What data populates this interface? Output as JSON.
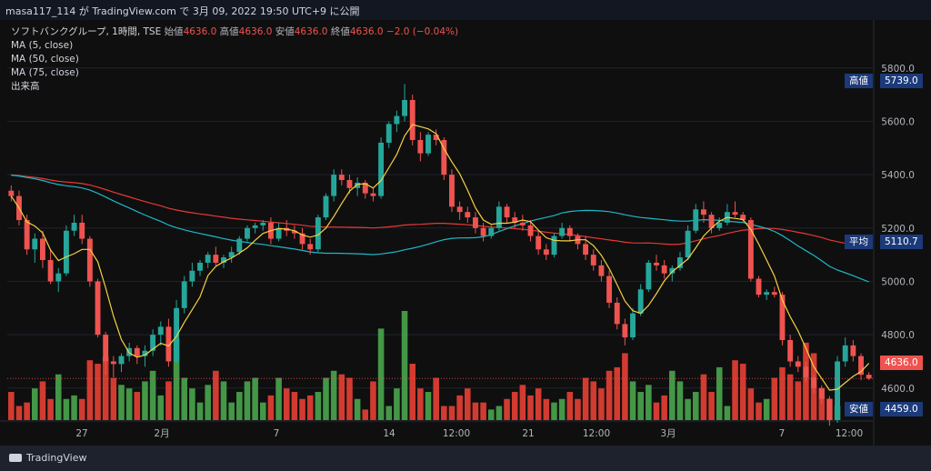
{
  "snapshot_header": "masa117_114 が TradingView.com で 3月 09, 2022 19:50 UTC+9 に公開",
  "legend": {
    "symbol": "ソフトバンクグループ, 1時間, TSE",
    "open_label": "始値",
    "open_value": "4636.0",
    "high_label": "高値",
    "high_value": "4636.0",
    "low_label": "安値",
    "low_value": "4636.0",
    "close_label": "終値",
    "close_value": "4636.0",
    "change": "−2.0 (−0.04%)",
    "indicators": [
      "MA (5, close)",
      "MA (50, close)",
      "MA (75, close)",
      "出来高"
    ]
  },
  "price_markers": {
    "high": {
      "label": "高値",
      "value": "5739.0"
    },
    "avg": {
      "label": "平均",
      "value": "5110.7"
    },
    "last": {
      "value": "4636.0"
    },
    "low": {
      "label": "安値",
      "value": "4459.0"
    }
  },
  "footer_brand": "TradingView",
  "colors": {
    "up": "#26a69a",
    "down": "#ef5350",
    "vol_up": "#4caf50",
    "vol_down": "#f44336",
    "ma5": "#f5d142",
    "ma50": "#1eb7c9",
    "ma75": "#e53935",
    "label_bg": "#1c3a7a"
  },
  "chart_data": {
    "type": "candlestick",
    "symbol": "ソフトバンクグループ",
    "interval": "1時間",
    "exchange": "TSE",
    "y_range": [
      4480,
      5980
    ],
    "y_ticks": [
      4600,
      4800,
      5000,
      5200,
      5400,
      5600,
      5800
    ],
    "x_labels": [
      "27",
      "2月",
      "7",
      "14",
      "12:00",
      "21",
      "12:00",
      "3月",
      "7",
      "12:00"
    ],
    "candles": [
      [
        5340,
        5360,
        5300,
        5320
      ],
      [
        5320,
        5340,
        5210,
        5230
      ],
      [
        5230,
        5250,
        5100,
        5120
      ],
      [
        5120,
        5180,
        5070,
        5160
      ],
      [
        5160,
        5190,
        5050,
        5080
      ],
      [
        5080,
        5120,
        4990,
        5000
      ],
      [
        5000,
        5050,
        4960,
        5030
      ],
      [
        5030,
        5210,
        5020,
        5190
      ],
      [
        5190,
        5250,
        5170,
        5220
      ],
      [
        5220,
        5250,
        5140,
        5160
      ],
      [
        5160,
        5170,
        4980,
        5000
      ],
      [
        5000,
        5010,
        4790,
        4800
      ],
      [
        4800,
        4810,
        4650,
        4700
      ],
      [
        4700,
        4720,
        4640,
        4690
      ],
      [
        4690,
        4730,
        4660,
        4720
      ],
      [
        4720,
        4770,
        4700,
        4750
      ],
      [
        4750,
        4760,
        4690,
        4720
      ],
      [
        4720,
        4760,
        4680,
        4740
      ],
      [
        4740,
        4820,
        4720,
        4800
      ],
      [
        4800,
        4850,
        4760,
        4830
      ],
      [
        4830,
        4860,
        4680,
        4700
      ],
      [
        4700,
        4930,
        4690,
        4900
      ],
      [
        4900,
        5020,
        4880,
        5000
      ],
      [
        5000,
        5070,
        4980,
        5040
      ],
      [
        5040,
        5080,
        5020,
        5070
      ],
      [
        5070,
        5110,
        5050,
        5100
      ],
      [
        5100,
        5130,
        5060,
        5070
      ],
      [
        5070,
        5100,
        5050,
        5090
      ],
      [
        5090,
        5130,
        5070,
        5110
      ],
      [
        5110,
        5170,
        5100,
        5160
      ],
      [
        5160,
        5210,
        5150,
        5200
      ],
      [
        5200,
        5220,
        5180,
        5210
      ],
      [
        5210,
        5230,
        5190,
        5220
      ],
      [
        5220,
        5240,
        5140,
        5160
      ],
      [
        5160,
        5220,
        5150,
        5200
      ],
      [
        5200,
        5230,
        5170,
        5190
      ],
      [
        5190,
        5210,
        5160,
        5180
      ],
      [
        5180,
        5200,
        5120,
        5140
      ],
      [
        5140,
        5160,
        5100,
        5120
      ],
      [
        5120,
        5250,
        5110,
        5240
      ],
      [
        5240,
        5330,
        5230,
        5320
      ],
      [
        5320,
        5420,
        5300,
        5400
      ],
      [
        5400,
        5420,
        5360,
        5380
      ],
      [
        5380,
        5400,
        5330,
        5350
      ],
      [
        5350,
        5390,
        5320,
        5370
      ],
      [
        5370,
        5380,
        5310,
        5330
      ],
      [
        5330,
        5350,
        5300,
        5320
      ],
      [
        5320,
        5540,
        5310,
        5520
      ],
      [
        5520,
        5600,
        5500,
        5590
      ],
      [
        5590,
        5640,
        5560,
        5620
      ],
      [
        5620,
        5740,
        5600,
        5680
      ],
      [
        5680,
        5700,
        5510,
        5530
      ],
      [
        5530,
        5560,
        5450,
        5480
      ],
      [
        5480,
        5560,
        5470,
        5550
      ],
      [
        5550,
        5570,
        5510,
        5530
      ],
      [
        5530,
        5540,
        5380,
        5400
      ],
      [
        5400,
        5420,
        5260,
        5280
      ],
      [
        5280,
        5300,
        5230,
        5260
      ],
      [
        5260,
        5280,
        5220,
        5240
      ],
      [
        5240,
        5260,
        5180,
        5200
      ],
      [
        5200,
        5220,
        5150,
        5170
      ],
      [
        5170,
        5210,
        5160,
        5200
      ],
      [
        5200,
        5300,
        5190,
        5280
      ],
      [
        5280,
        5290,
        5220,
        5240
      ],
      [
        5240,
        5260,
        5200,
        5220
      ],
      [
        5220,
        5250,
        5190,
        5210
      ],
      [
        5210,
        5230,
        5150,
        5170
      ],
      [
        5170,
        5190,
        5100,
        5120
      ],
      [
        5120,
        5140,
        5080,
        5100
      ],
      [
        5100,
        5180,
        5090,
        5170
      ],
      [
        5170,
        5220,
        5160,
        5200
      ],
      [
        5200,
        5210,
        5150,
        5170
      ],
      [
        5170,
        5180,
        5120,
        5140
      ],
      [
        5140,
        5170,
        5080,
        5100
      ],
      [
        5100,
        5120,
        5040,
        5060
      ],
      [
        5060,
        5080,
        5000,
        5020
      ],
      [
        5020,
        5040,
        4900,
        4920
      ],
      [
        4920,
        4940,
        4820,
        4840
      ],
      [
        4840,
        4860,
        4760,
        4790
      ],
      [
        4790,
        4900,
        4780,
        4880
      ],
      [
        4880,
        4990,
        4870,
        4970
      ],
      [
        4970,
        5080,
        4960,
        5070
      ],
      [
        5070,
        5100,
        5040,
        5060
      ],
      [
        5060,
        5080,
        5010,
        5030
      ],
      [
        5030,
        5060,
        5000,
        5050
      ],
      [
        5050,
        5110,
        5040,
        5090
      ],
      [
        5090,
        5210,
        5080,
        5190
      ],
      [
        5190,
        5290,
        5180,
        5270
      ],
      [
        5270,
        5300,
        5220,
        5250
      ],
      [
        5250,
        5260,
        5180,
        5200
      ],
      [
        5200,
        5240,
        5190,
        5220
      ],
      [
        5220,
        5290,
        5210,
        5260
      ],
      [
        5260,
        5300,
        5240,
        5250
      ],
      [
        5250,
        5260,
        5220,
        5230
      ],
      [
        5230,
        5240,
        5000,
        5010
      ],
      [
        5010,
        5020,
        4940,
        4950
      ],
      [
        4950,
        4970,
        4930,
        4960
      ],
      [
        4960,
        4980,
        4940,
        4950
      ],
      [
        4950,
        4960,
        4760,
        4780
      ],
      [
        4780,
        4800,
        4680,
        4700
      ],
      [
        4700,
        4720,
        4660,
        4680
      ],
      [
        4680,
        4700,
        4620,
        4640
      ],
      [
        4640,
        4650,
        4580,
        4600
      ],
      [
        4600,
        4610,
        4540,
        4560
      ],
      [
        4560,
        4570,
        4459,
        4480
      ],
      [
        4480,
        4720,
        4470,
        4700
      ],
      [
        4700,
        4790,
        4680,
        4760
      ],
      [
        4760,
        4780,
        4700,
        4720
      ],
      [
        4720,
        4730,
        4630,
        4650
      ],
      [
        4650,
        4660,
        4630,
        4636
      ]
    ],
    "volume": [
      40,
      20,
      25,
      45,
      55,
      30,
      65,
      30,
      35,
      30,
      85,
      80,
      90,
      60,
      50,
      45,
      40,
      55,
      70,
      35,
      55,
      115,
      60,
      45,
      25,
      50,
      70,
      55,
      25,
      40,
      55,
      60,
      25,
      35,
      60,
      45,
      40,
      30,
      35,
      40,
      60,
      70,
      65,
      60,
      30,
      15,
      55,
      130,
      20,
      45,
      155,
      80,
      45,
      40,
      60,
      20,
      20,
      35,
      45,
      25,
      25,
      15,
      20,
      30,
      40,
      50,
      35,
      45,
      30,
      25,
      30,
      40,
      30,
      60,
      55,
      45,
      70,
      75,
      95,
      55,
      40,
      50,
      25,
      35,
      70,
      55,
      30,
      40,
      65,
      40,
      75,
      20,
      85,
      80,
      45,
      25,
      30,
      60,
      75,
      65,
      55,
      110,
      95,
      45,
      30,
      20
    ]
  }
}
